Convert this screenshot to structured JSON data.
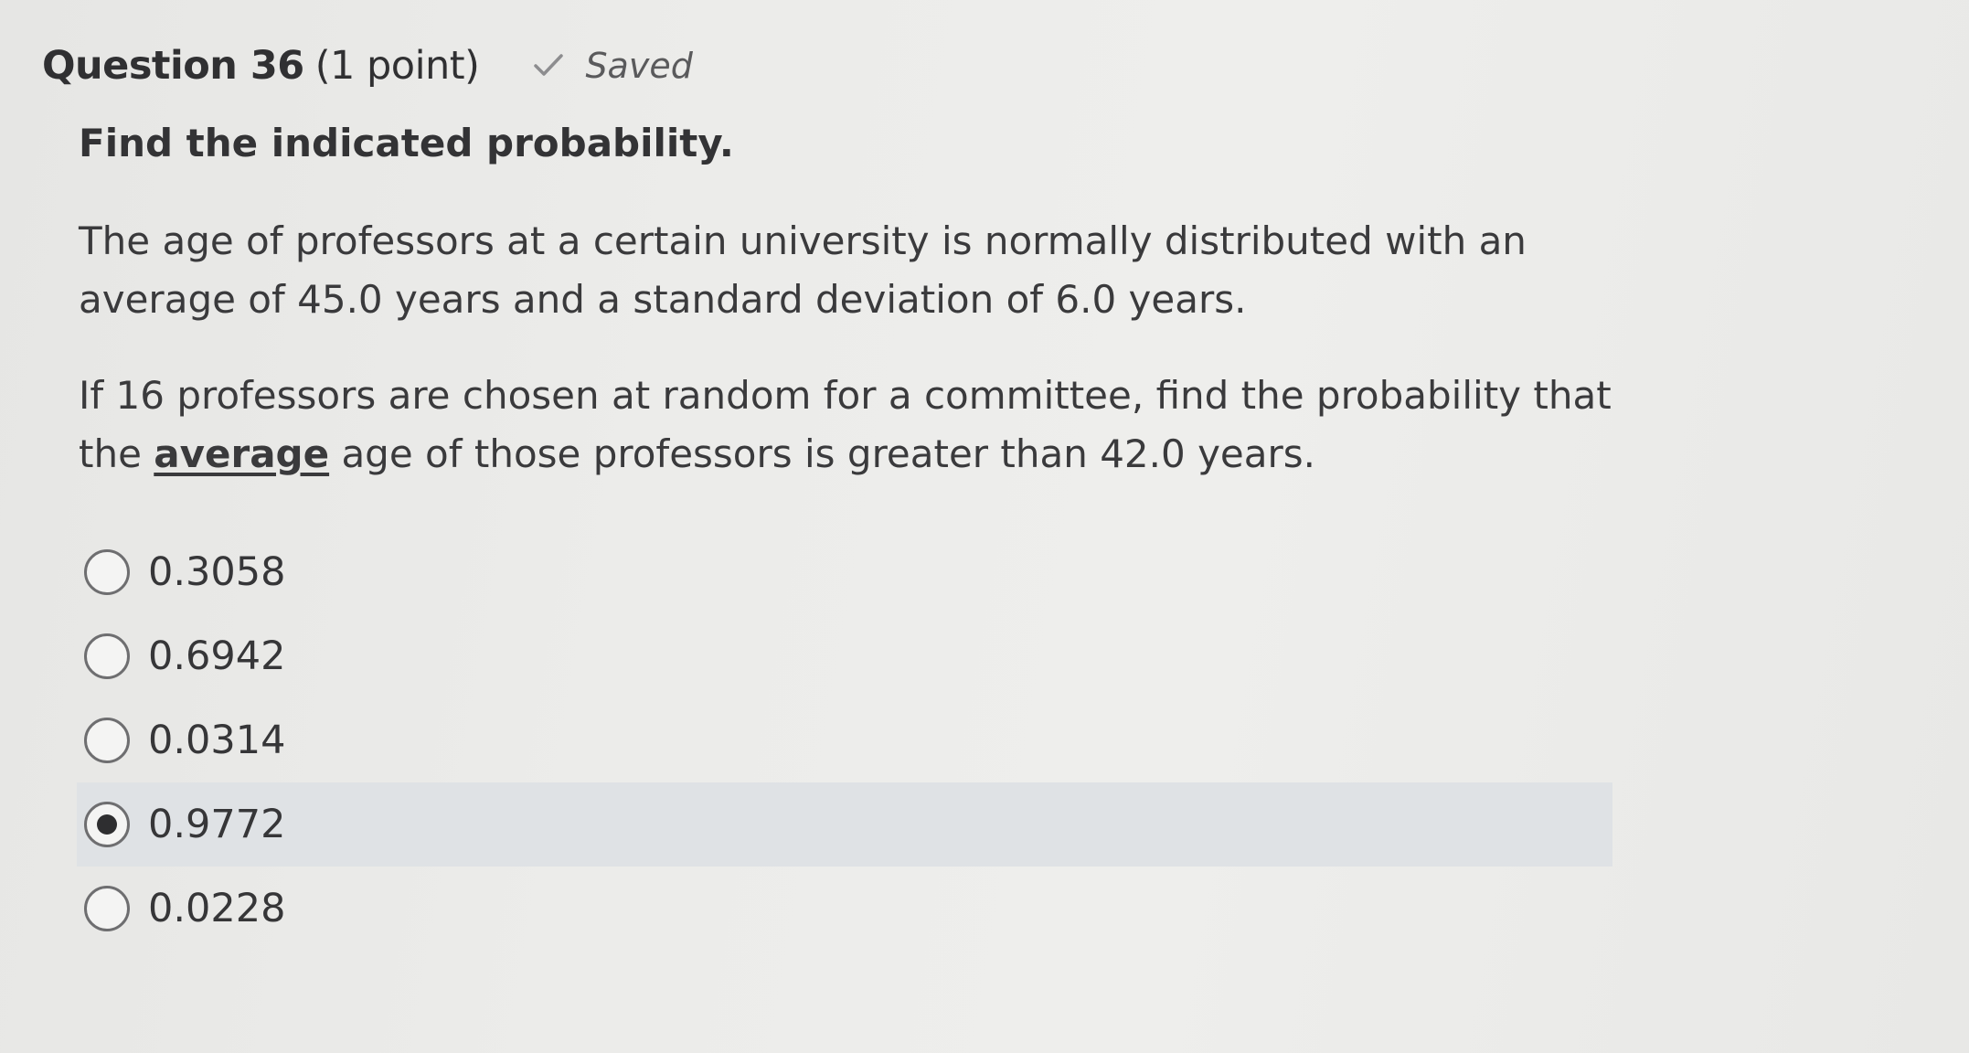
{
  "header": {
    "title": "Question 36",
    "points": "(1 point)",
    "status": "Saved",
    "status_icon": "check-icon"
  },
  "instruction": "Find the indicated probability.",
  "paragraph1": "The age of professors at a certain university is normally distributed with an average of 45.0 years and a standard deviation of 6.0 years.",
  "paragraph2": {
    "before": "If 16 professors are chosen at random for a committee, find the probability that the ",
    "emphasis": "average",
    "after": " age of those professors is greater than 42.0 years."
  },
  "options": [
    {
      "label": "0.3058",
      "selected": false
    },
    {
      "label": "0.6942",
      "selected": false
    },
    {
      "label": "0.0314",
      "selected": false
    },
    {
      "label": "0.9772",
      "selected": true
    },
    {
      "label": "0.0228",
      "selected": false
    }
  ],
  "colors": {
    "selected_row": "#dfe2e5",
    "text": "#3a3a3c"
  }
}
